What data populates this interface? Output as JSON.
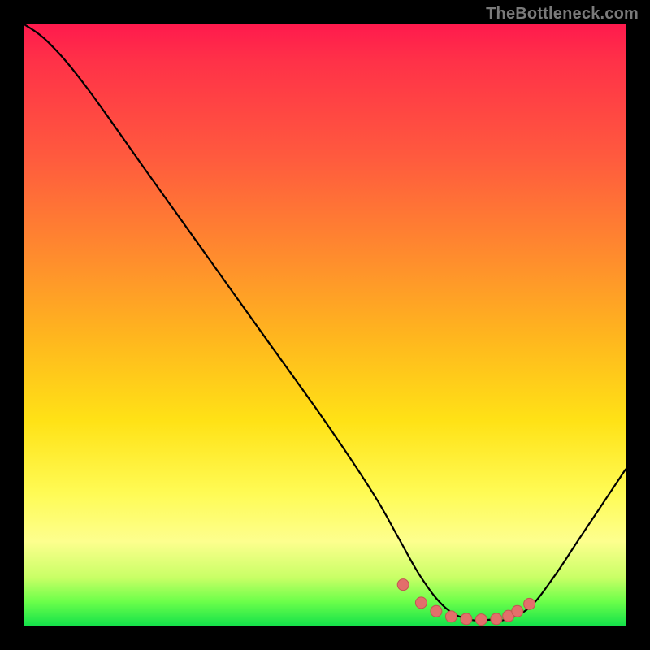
{
  "watermark": "TheBottleneck.com",
  "colors": {
    "frame": "#000000",
    "curve": "#000000",
    "marker": "#e36f6b",
    "marker_border": "#c25651",
    "gradient_stops": [
      "#ff1a4d",
      "#ff5a3e",
      "#ff8a2e",
      "#ffb61e",
      "#ffe216",
      "#fffb55",
      "#fdff8e",
      "#c9ff66",
      "#6cff4a",
      "#15e24a"
    ]
  },
  "chart_data": {
    "type": "line",
    "title": "",
    "xlabel": "",
    "ylabel": "",
    "xlim": [
      0,
      100
    ],
    "ylim": [
      0,
      100
    ],
    "series": [
      {
        "name": "bottleneck-curve",
        "x": [
          0,
          4,
          10,
          20,
          30,
          40,
          50,
          58,
          62,
          66,
          70,
          74,
          78,
          80,
          84,
          88,
          92,
          96,
          100
        ],
        "values": [
          100,
          97,
          90,
          76,
          62,
          48,
          34,
          22,
          15,
          8,
          3,
          1,
          1,
          1,
          3,
          8,
          14,
          20,
          26
        ]
      }
    ],
    "markers": {
      "name": "sweet-spot-dots",
      "x": [
        63,
        66,
        68.5,
        71,
        73.5,
        76,
        78.5,
        80.5,
        82,
        84
      ],
      "values": [
        6.8,
        3.8,
        2.4,
        1.5,
        1.1,
        1.0,
        1.1,
        1.6,
        2.4,
        3.6
      ]
    }
  }
}
